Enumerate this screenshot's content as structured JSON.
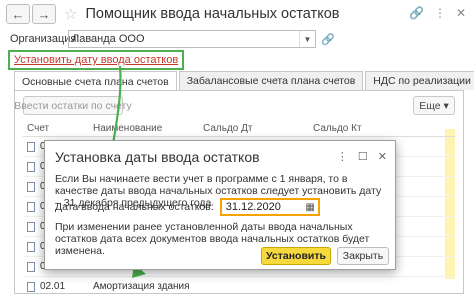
{
  "window": {
    "title": "Помощник ввода начальных остатков",
    "back_label": "←",
    "forward_label": "→",
    "star_label": "☆",
    "link_icon": "🔗",
    "more_icon": "⋮",
    "close_icon": "✕"
  },
  "organization": {
    "label": "Организация:",
    "value": "Лаванда ООО",
    "dropdown_icon": "▼",
    "open_icon": "🔗"
  },
  "set_date_link": "Установить дату ввода остатков",
  "tabs": [
    {
      "label": "Основные счета плана счетов"
    },
    {
      "label": "Забалансовые счета плана счетов"
    },
    {
      "label": "НДС по реализации"
    }
  ],
  "toolbar": {
    "enter_balances_label": "Ввести остатки по счету",
    "more_label": "Еще ▾"
  },
  "table": {
    "columns": [
      "Счет",
      "Наименование",
      "Сальдо Дт",
      "Сальдо Кт"
    ],
    "rows": [
      {
        "account": "01",
        "name": "",
        "dt": "",
        "kt": ""
      },
      {
        "account": "01",
        "name": "",
        "dt": "",
        "kt": ""
      },
      {
        "account": "02",
        "name": "",
        "dt": "",
        "kt": ""
      },
      {
        "account": "02",
        "name": "",
        "dt": "",
        "kt": ""
      },
      {
        "account": "02",
        "name": "",
        "dt": "",
        "kt": ""
      },
      {
        "account": "02",
        "name": "",
        "dt": "",
        "kt": ""
      },
      {
        "account": "02",
        "name": "",
        "dt": "",
        "kt": ""
      },
      {
        "account": "02.01",
        "name": "Амортизация здания",
        "dt": "",
        "kt": ""
      }
    ]
  },
  "dialog": {
    "title": "Установка даты ввода остатков",
    "menu_icon": "⋮",
    "maximize_icon": "☐",
    "close_icon": "✕",
    "text1": "Если Вы начинаете вести учет в программе с 1 января, то в качестве даты ввода начальных остатков следует установить дату – 31 декабря предыдущего года",
    "date_label": "Дата ввода начальных остатков:",
    "date_value": "31.12.2020",
    "calendar_icon": "▦",
    "text2": "При изменении ранее установленной даты ввода начальных остатков дата всех документов ввода начальных остатков будет изменена.",
    "set_button": "Установить",
    "close_button": "Закрыть"
  },
  "colors": {
    "highlight_green": "#4caf50",
    "link_red": "#c0392b",
    "date_focus": "#f4a300",
    "primary_button": "#f7d93d"
  }
}
